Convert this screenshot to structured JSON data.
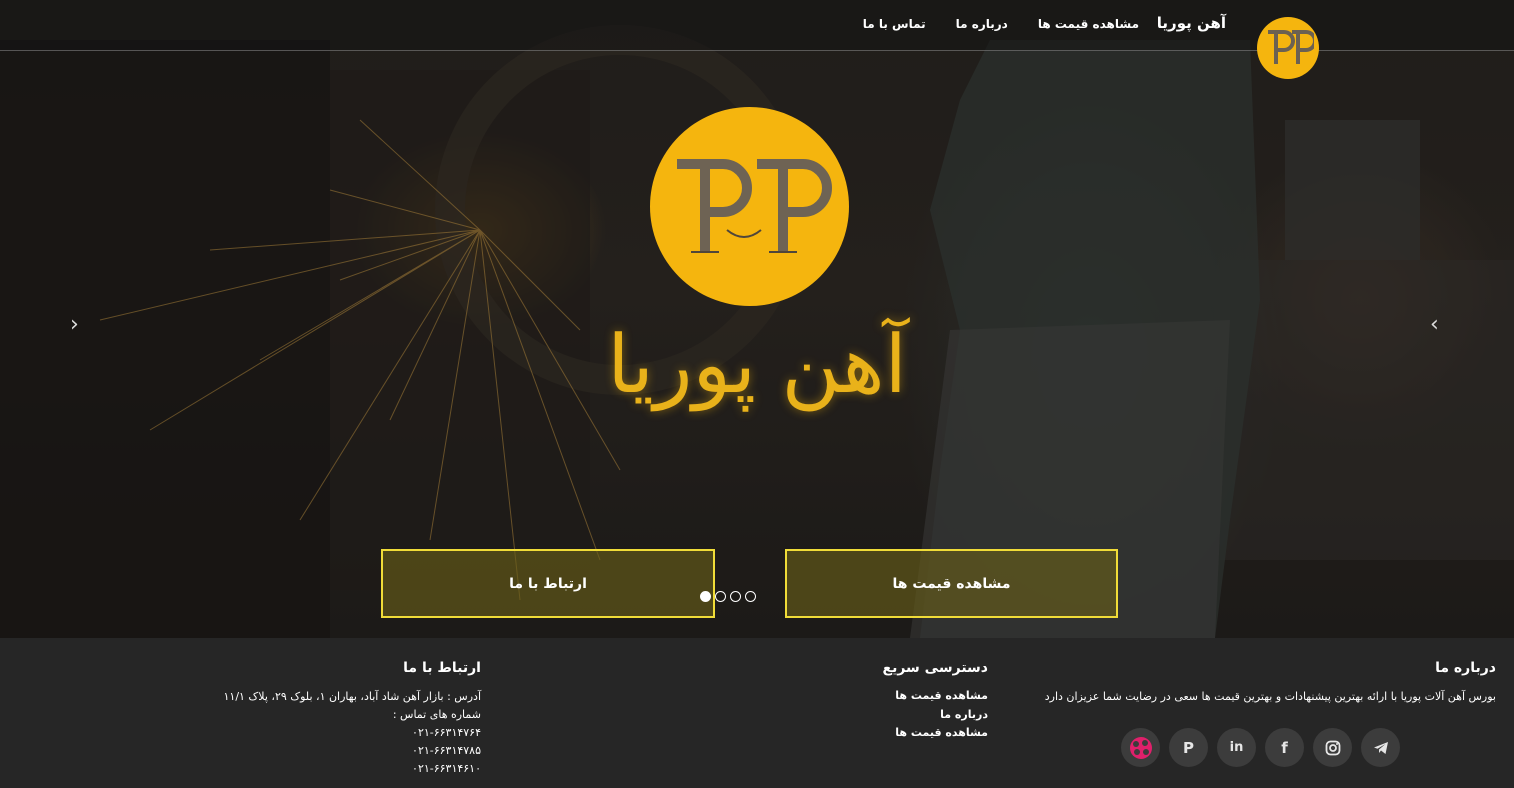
{
  "nav": {
    "logo_letters": "PP",
    "brand": "آهن پوریا",
    "links": [
      "مشاهده قیمت ها",
      "درباره ما",
      "تماس با ما"
    ]
  },
  "hero": {
    "title": "آهن پوریا",
    "prev_arrow": "‹",
    "next_arrow": "›",
    "cta_contact": "ارتباط با ما",
    "cta_prices": "مشاهده قیمت ها",
    "slides_count": 4,
    "active_slide": 1
  },
  "footer": {
    "about": {
      "heading": "درباره ما",
      "text": "بورس آهن آلات پوریا با ارائه بهترین پیشنهادات و بهترین قیمت ها سعی در رضایت شما عزیزان دارد"
    },
    "quick": {
      "heading": "دسترسی سریع",
      "links": [
        "مشاهده قیمت ها",
        "درباره ما",
        "مشاهده قیمت ها"
      ]
    },
    "contact": {
      "heading": "ارتباط با ما",
      "address": "آدرس : بازار آهن شاد آباد، بهاران ۱، بلوک ۲۹، پلاک ۱۱/۱",
      "phones_label": "شماره های تماس :",
      "phones": [
        "۰۲۱-۶۶۳۱۴۷۶۴",
        "۰۲۱-۶۶۳۱۴۷۸۵",
        "۰۲۱-۶۶۳۱۴۶۱۰"
      ]
    },
    "social": [
      "aparat-icon",
      "pinterest-icon",
      "linkedin-icon",
      "facebook-icon",
      "instagram-icon",
      "telegram-icon"
    ]
  },
  "colors": {
    "brand_yellow": "#f5b50e",
    "cta_border": "#f0dc38",
    "footer_bg": "#262626"
  }
}
